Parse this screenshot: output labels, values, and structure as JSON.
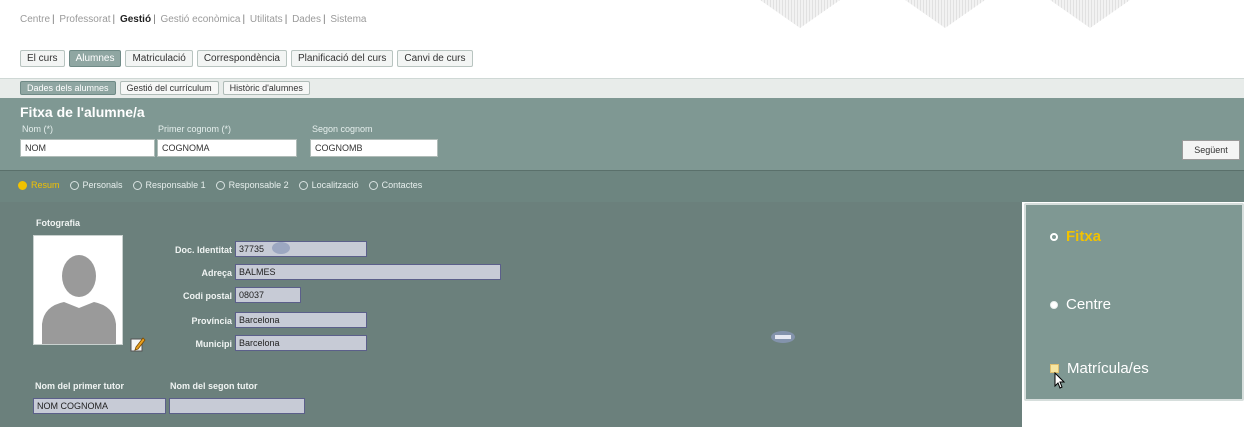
{
  "top_nav": {
    "items": [
      "Centre",
      "Professorat",
      "Gestió",
      "Gestió econòmica",
      "Utilitats",
      "Dades",
      "Sistema"
    ],
    "active_index": 2
  },
  "main_tabs": [
    "El curs",
    "Alumnes",
    "Matriculació",
    "Correspondència",
    "Planificació del curs",
    "Canvi de curs"
  ],
  "main_tab_active": 1,
  "sub_tabs": [
    "Dades dels alumnes",
    "Gestió del currículum",
    "Històric d'alumnes"
  ],
  "sub_tab_active": 0,
  "fitxa": {
    "title": "Fitxa de l'alumne/a",
    "nom_label": "Nom (*)",
    "nom_value": "NOM",
    "cognom1_label": "Primer cognom (*)",
    "cognom1_value": "COGNOMA",
    "cognom2_label": "Segon cognom",
    "cognom2_value": "COGNOMB",
    "next_button": "Següent"
  },
  "radio_tabs": [
    "Resum",
    "Personals",
    "Responsable 1",
    "Responsable 2",
    "Localització",
    "Contactes"
  ],
  "radio_selected": 0,
  "details": {
    "foto_label": "Fotografia",
    "doc_label": "Doc. Identitat",
    "doc_value": "37735",
    "adreca_label": "Adreça",
    "adreca_value": "BALMES",
    "cp_label": "Codi postal",
    "cp_value": "08037",
    "provincia_label": "Província",
    "provincia_value": "Barcelona",
    "municipi_label": "Municipi",
    "municipi_value": "Barcelona",
    "tutor1_label": "Nom del primer tutor",
    "tutor1_value": "NOM COGNOMA",
    "tutor2_label": "Nom del segon tutor",
    "tutor2_value": ""
  },
  "side_nav": {
    "items": [
      "Fitxa",
      "Centre",
      "Matrícula/es"
    ],
    "selected": 0
  },
  "colors": {
    "header_bg": "#7f9893",
    "body_bg": "#6b807c",
    "accent_yellow": "#f2c200",
    "input_bg": "#c7cbd6"
  },
  "icons": [
    "edit-icon",
    "avatar-placeholder-icon",
    "mouse-cursor-icon"
  ]
}
